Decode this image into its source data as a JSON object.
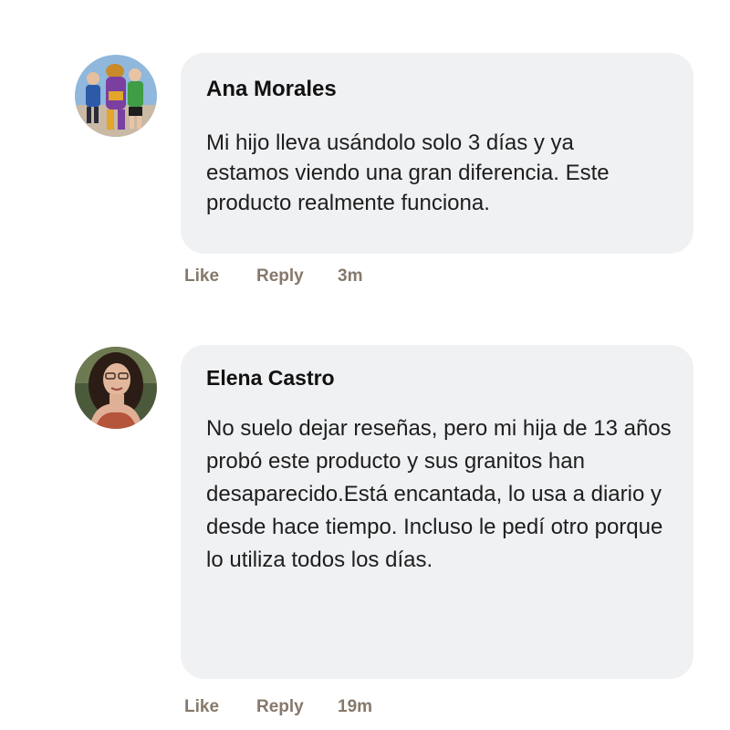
{
  "comments": [
    {
      "author": "Ana Morales",
      "text": "Mi hijo lleva usándolo solo 3 días y ya estamos viendo una gran diferencia. Este producto realmente funciona.",
      "like_label": "Like",
      "reply_label": "Reply",
      "time": "3m",
      "avatar_icon": "avatar-photo-family"
    },
    {
      "author": "Elena Castro",
      "text": "No suelo dejar reseñas, pero mi hija de 13 años probó este producto y sus granitos han desaparecido.Está encantada, lo usa a diario y desde hace tiempo. Incluso le pedí otro porque lo utiliza todos los días.",
      "like_label": "Like",
      "reply_label": "Reply",
      "time": "19m",
      "avatar_icon": "avatar-photo-woman"
    }
  ],
  "colors": {
    "bubble_background": "#f0f1f3",
    "action_text": "#86786a",
    "author_text": "#111111"
  }
}
